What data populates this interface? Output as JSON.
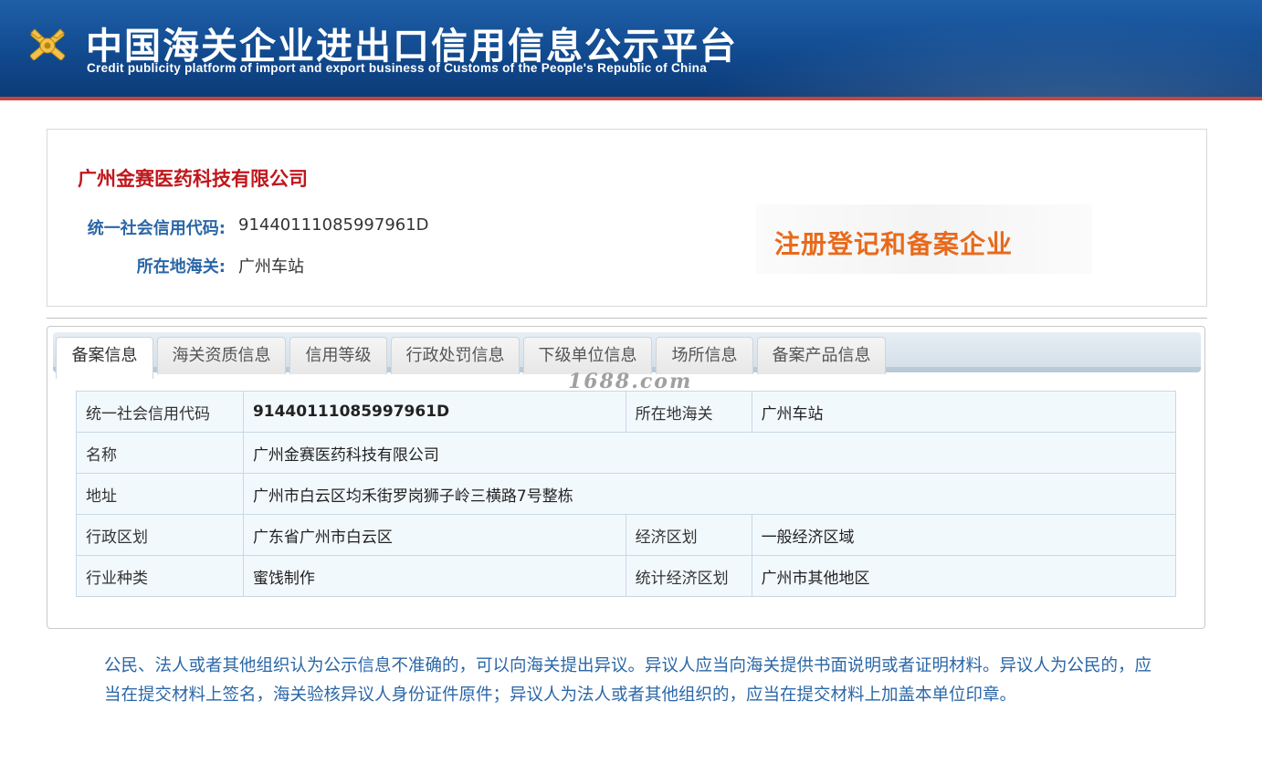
{
  "header": {
    "title": "中国海关企业进出口信用信息公示平台",
    "subtitle": "Credit publicity platform of import and export business of Customs of the People's Republic of China"
  },
  "company": {
    "name": "广州金赛医药科技有限公司",
    "credit_code_label": "统一社会信用代码:",
    "credit_code": "91440111085997961D",
    "customs_label": "所在地海关:",
    "customs": "广州车站",
    "status_stamp": "注册登记和备案企业"
  },
  "tabs": [
    {
      "label": "备案信息",
      "active": true
    },
    {
      "label": "海关资质信息",
      "active": false
    },
    {
      "label": "信用等级",
      "active": false
    },
    {
      "label": "行政处罚信息",
      "active": false
    },
    {
      "label": "下级单位信息",
      "active": false
    },
    {
      "label": "场所信息",
      "active": false
    },
    {
      "label": "备案产品信息",
      "active": false
    }
  ],
  "watermark": "1688.com",
  "table": {
    "rows": [
      {
        "l1": "统一社会信用代码",
        "v1": "91440111085997961D",
        "l2": "所在地海关",
        "v2": "广州车站"
      },
      {
        "l1": "名称",
        "v1": "广州金赛医药科技有限公司"
      },
      {
        "l1": "地址",
        "v1": "广州市白云区均禾街罗岗狮子岭三横路7号整栋"
      },
      {
        "l1": "行政区划",
        "v1": "广东省广州市白云区",
        "l2": "经济区划",
        "v2": "一般经济区域"
      },
      {
        "l1": "行业种类",
        "v1": "蜜饯制作",
        "l2": "统计经济区划",
        "v2": "广州市其他地区"
      }
    ]
  },
  "notice": "公民、法人或者其他组织认为公示信息不准确的，可以向海关提出异议。异议人应当向海关提供书面说明或者证明材料。异议人为公民的，应当在提交材料上签名，海关验核异议人身份证件原件；异议人为法人或者其他组织的，应当在提交材料上加盖本单位印章。",
  "colors": {
    "banner": "#114a8f",
    "company_name": "#c0171c",
    "label_blue": "#2b67a7",
    "stamp_orange": "#e86a1c"
  }
}
